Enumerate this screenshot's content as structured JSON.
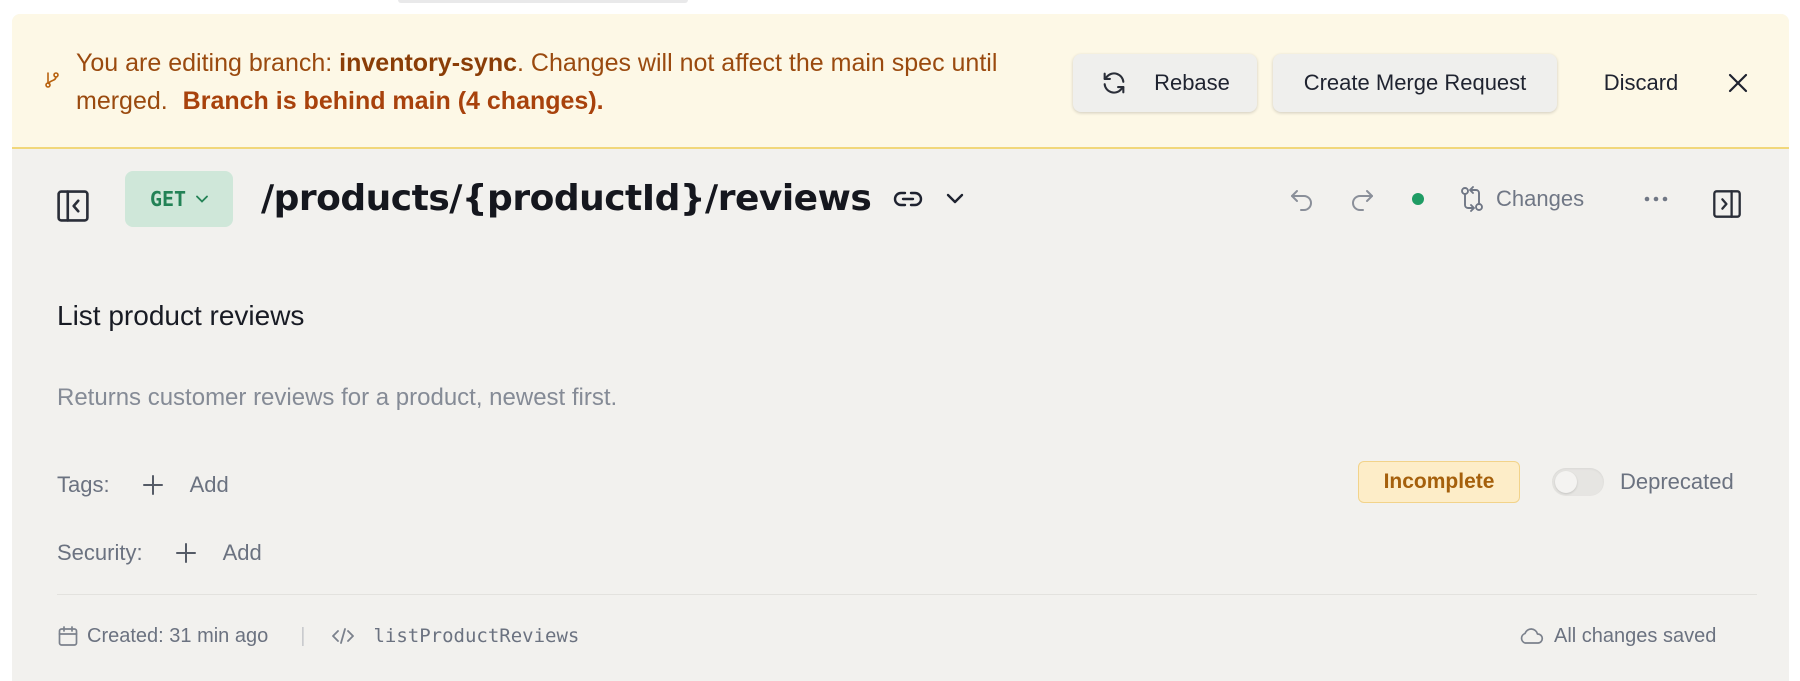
{
  "banner": {
    "prefix": "You are editing branch:",
    "branch": "inventory-sync",
    "suffix": ". Changes will not affect the main spec until merged.",
    "behind": "Branch is behind main (4 changes).",
    "rebase_label": "Rebase",
    "merge_label": "Create Merge Request",
    "discard_label": "Discard",
    "icon": "branch-icon"
  },
  "header": {
    "method": "GET",
    "path": "/products/{productId}/reviews",
    "changes_label": "Changes",
    "status_color": "#1f9c64"
  },
  "endpoint": {
    "summary": "List product reviews",
    "description": "Returns customer reviews for a product, newest first.",
    "tags_label": "Tags:",
    "security_label": "Security:",
    "add_label": "Add",
    "status_badge": "Incomplete",
    "deprecated_label": "Deprecated",
    "deprecated_enabled": false
  },
  "footer": {
    "created": "Created: 31 min ago",
    "separator": "|",
    "operation_id": "listProductReviews",
    "save_status": "All changes saved"
  }
}
